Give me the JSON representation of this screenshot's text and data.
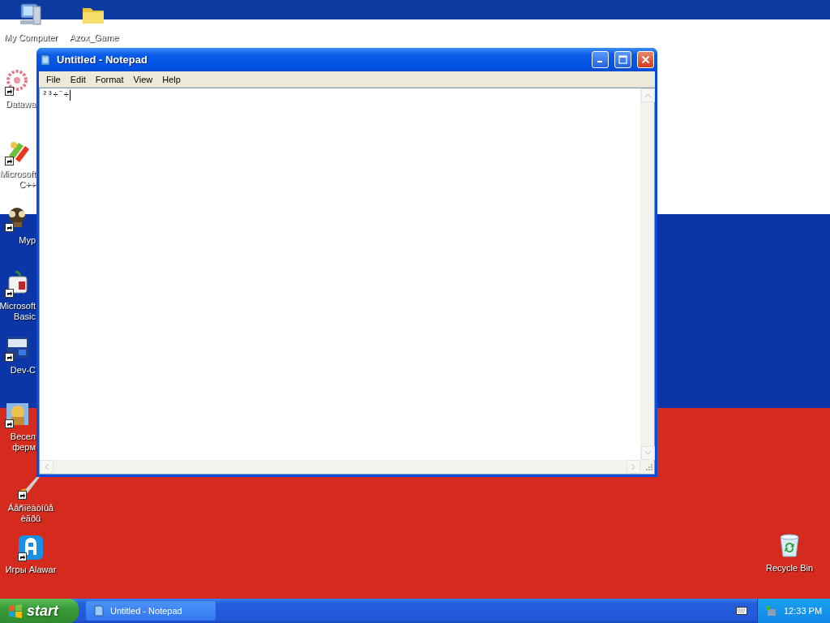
{
  "desktop": {
    "icons": [
      {
        "kind": "computer",
        "shortcut": false,
        "label": [
          "My Computer"
        ]
      },
      {
        "kind": "folder",
        "shortcut": false,
        "label": [
          "Azox_Game"
        ]
      },
      {
        "kind": "flower",
        "shortcut": true,
        "label": [
          "Datawa"
        ]
      },
      {
        "kind": "pencil",
        "shortcut": true,
        "label": [
          "Microsoft",
          "C++"
        ]
      },
      {
        "kind": "character",
        "shortcut": true,
        "label": [
          "Myp"
        ]
      },
      {
        "kind": "game",
        "shortcut": true,
        "label": [
          "Microsoft",
          "Basic"
        ]
      },
      {
        "kind": "dev",
        "shortcut": true,
        "label": [
          "Dev-C"
        ]
      },
      {
        "kind": "farm",
        "shortcut": true,
        "label": [
          "Весел",
          "ферм"
        ]
      },
      {
        "kind": "brush",
        "shortcut": true,
        "label": [
          "Áåñïëàòíûå",
          "èãðû"
        ]
      },
      {
        "kind": "alawar",
        "shortcut": true,
        "label": [
          "Игры Alawar"
        ]
      },
      {
        "kind": "recycle",
        "shortcut": false,
        "label": [
          "Recycle Bin"
        ]
      }
    ]
  },
  "window": {
    "title": "Untitled - Notepad",
    "menu": [
      "File",
      "Edit",
      "Format",
      "View",
      "Help"
    ],
    "text": "²³÷¨÷"
  },
  "taskbar": {
    "start": "start",
    "tasks": [
      {
        "label": "Untitled - Notepad"
      }
    ],
    "clock": "12:33 PM"
  }
}
